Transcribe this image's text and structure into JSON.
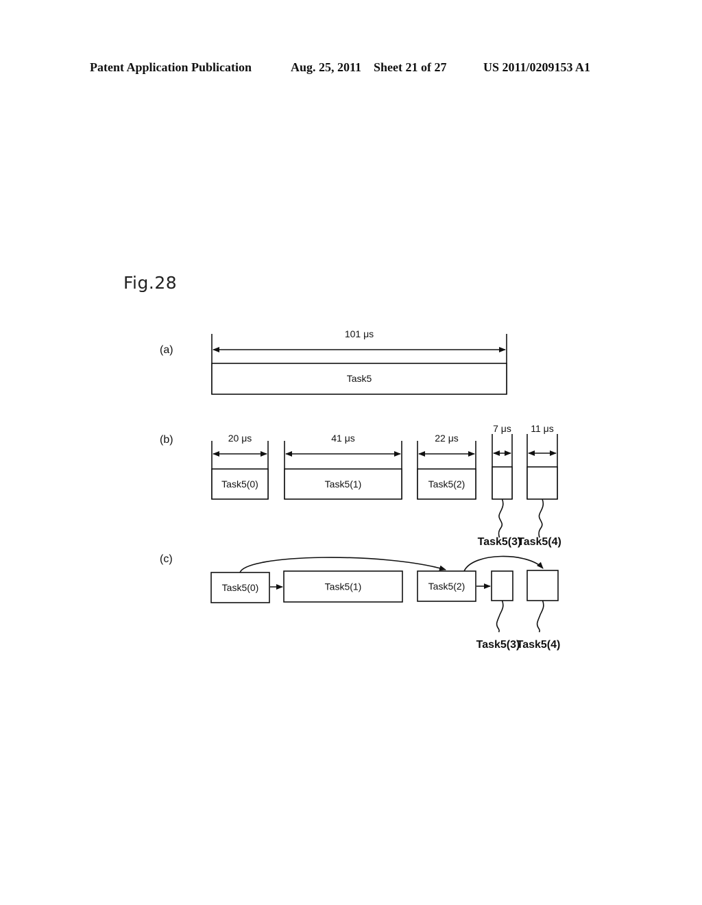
{
  "header": {
    "publication": "Patent Application Publication",
    "date": "Aug. 25, 2011",
    "sheet": "Sheet 21 of 27",
    "number": "US 2011/0209153 A1"
  },
  "figure": {
    "label": "Fig.28",
    "parts": {
      "a": {
        "label": "(a)",
        "task": {
          "name": "Task5",
          "duration": "101 μs"
        }
      },
      "b": {
        "label": "(b)",
        "tasks": [
          {
            "name": "Task5(0)",
            "duration": "20 μs",
            "callout": false
          },
          {
            "name": "Task5(1)",
            "duration": "41 μs",
            "callout": false
          },
          {
            "name": "Task5(2)",
            "duration": "22 μs",
            "callout": false
          },
          {
            "name": "Task5(3)",
            "duration": "7 μs",
            "callout": true
          },
          {
            "name": "Task5(4)",
            "duration": "11 μs",
            "callout": true
          }
        ]
      },
      "c": {
        "label": "(c)",
        "tasks": [
          {
            "name": "Task5(0)",
            "callout": false
          },
          {
            "name": "Task5(1)",
            "callout": false
          },
          {
            "name": "Task5(2)",
            "callout": false
          },
          {
            "name": "Task5(3)",
            "callout": true
          },
          {
            "name": "Task5(4)",
            "callout": true
          }
        ],
        "edges": [
          {
            "from": "Task5(0)",
            "to": "Task5(1)",
            "style": "straight"
          },
          {
            "from": "Task5(0)",
            "to": "Task5(2)",
            "style": "curved"
          },
          {
            "from": "Task5(2)",
            "to": "Task5(3)",
            "style": "straight"
          },
          {
            "from": "Task5(2)",
            "to": "Task5(4)",
            "style": "curved"
          }
        ]
      }
    }
  }
}
